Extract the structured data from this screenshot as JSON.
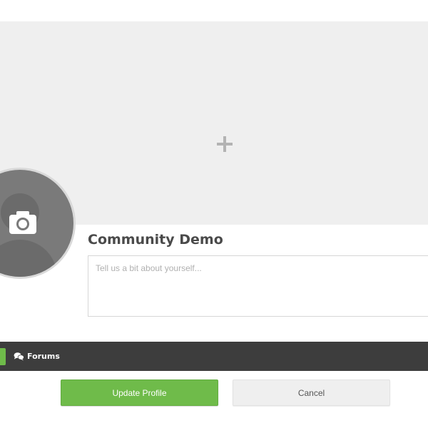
{
  "profile": {
    "name": "Community Demo",
    "bio_placeholder": "Tell us a bit about yourself...",
    "bio_value": ""
  },
  "cover": {
    "add_icon": "plus-icon"
  },
  "avatar": {
    "icon": "camera-icon"
  },
  "nav": {
    "items": [
      {
        "label": "Forums",
        "icon": "chat-bubbles-icon"
      }
    ]
  },
  "actions": {
    "update_label": "Update Profile",
    "cancel_label": "Cancel"
  },
  "colors": {
    "accent": "#6fbb4a",
    "navbar": "#3d3d3d",
    "cover": "#efefef",
    "avatar": "#7a7a7a",
    "text": "#4a4a4a"
  }
}
